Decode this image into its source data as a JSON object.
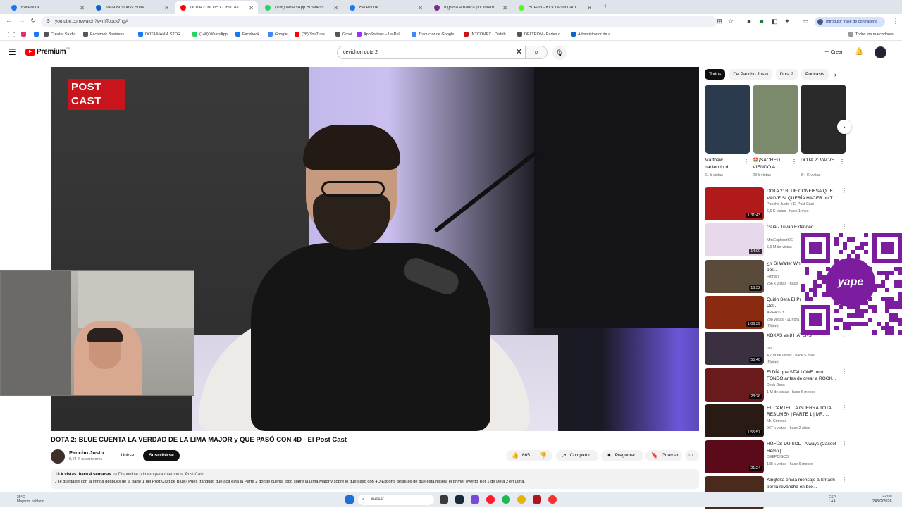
{
  "browser": {
    "tabs": [
      {
        "label": "Facebook",
        "color": "#1877f2",
        "active": false
      },
      {
        "label": "Meta Business Suite",
        "color": "#0a66c2",
        "active": false
      },
      {
        "label": "DOTA 2: BLUE CUENTA LA V...",
        "color": "#ff0000",
        "active": true
      },
      {
        "label": "(108) WhatsApp Business",
        "color": "#25d366",
        "active": false
      },
      {
        "label": "Facebook",
        "color": "#1877f2",
        "active": false
      },
      {
        "label": "Ingresa a Banca por Internet B...",
        "color": "#7a2b8f",
        "active": false
      },
      {
        "label": "Stream - Kick Dashboard",
        "color": "#53fc18",
        "active": false
      }
    ],
    "new_tab": "+",
    "url": "youtube.com/watch?v=nIToock7hgA",
    "sync_label": "Introducir frase de contraseña",
    "bookmarks": [
      {
        "label": "",
        "color": "#e1306c"
      },
      {
        "label": "",
        "color": "#1877f2"
      },
      {
        "label": "Creator Studio",
        "color": "#555"
      },
      {
        "label": "Facebook Business...",
        "color": "#555"
      },
      {
        "label": "DOTA MANIA STOR...",
        "color": "#1877f2"
      },
      {
        "label": "(140) WhatsApp",
        "color": "#25d366"
      },
      {
        "label": "Facebook",
        "color": "#1877f2"
      },
      {
        "label": "Google",
        "color": "#4285f4"
      },
      {
        "label": "(28) YouTube",
        "color": "#ff0000"
      },
      {
        "label": "Gmail",
        "color": "#555"
      },
      {
        "label": "AppSorteos – La Rul...",
        "color": "#9b30ff"
      },
      {
        "label": "Traductor de Google",
        "color": "#4285f4"
      },
      {
        "label": "INTCOMEX - Distrib...",
        "color": "#c8141b"
      },
      {
        "label": "DELTRON - Partes d...",
        "color": "#555"
      },
      {
        "label": "Administrador de a...",
        "color": "#0a66c2"
      }
    ],
    "all_bookmarks": "Todos los marcadores"
  },
  "youtube": {
    "logo": "Premium",
    "logo_sup": "PE",
    "search_value": "cevichon dota 2",
    "create_label": "Crear"
  },
  "video": {
    "overlay_logo": "POST CAST",
    "title": "DOTA 2: BLUE CUENTA LA VERDAD DE LA LIMA MAJOR y QUE PASÓ CON 4D - El Post Cast",
    "channel": "Pancho Justo",
    "subscribers": "9,64 K suscriptores",
    "join_label": "Unirse",
    "subscribe_label": "Suscribirse",
    "likes": "665",
    "share_label": "Compartir",
    "ask_label": "Preguntar",
    "save_label": "Guardar",
    "views": "13 k vistas",
    "ago": "hace 4 semanas",
    "members": "Disponible primero para miembros",
    "tag": "Post Cast",
    "description": "¿Te quedaste con la intriga después de la parte 1 del Post Cast de Blue? Pues tranquilo que acá está la Parte 2 donde cuenta todo sobre la Lima Major y sobre lo que pasó con 4D Esports después de que esta hiciera el primer evento Tier 1 de Dota 2 en Lima."
  },
  "sidebar": {
    "chips": [
      "Todos",
      "De Pancho Justo",
      "Dota 2",
      "Pódcasts"
    ],
    "shorts": [
      {
        "title": "Matthew haciendo d...",
        "views": "61 k vistas",
        "bg": "#2c3a4e"
      },
      {
        "title": "🤩¡SACRED VIENDO A ...",
        "views": "23 k vistas",
        "bg": "#7a8a6a"
      },
      {
        "title": "DOTA 2: VALVE ...",
        "views": "8,4 K vistas",
        "bg": "#2a2a2a"
      }
    ],
    "recs": [
      {
        "title": "DOTA 2: BLUE CONFIESA QUE VALVE SI QUERÍA HACER un T...",
        "channel": "Pancho Justo y El Post Cast",
        "views": "6,6 K vistas · hace 1 mes",
        "duration": "1:31:43",
        "bg": "#b01a1a",
        "new": ""
      },
      {
        "title": "Gaia - Tuvan Extended",
        "channel": "MiniExplorerSG",
        "views": "5,9 M de vistas",
        "duration": "14:00",
        "bg": "#e8d8ec",
        "new": ""
      },
      {
        "title": "¿Y Si Walter White... Sentenciado por...",
        "channel": "Hitman",
        "views": "256 k vistas · hace",
        "duration": "16:52",
        "bg": "#5a4a3a",
        "new": ""
      },
      {
        "title": "Quién Será El Próximo Presidente Del...",
        "channel": "AREA 973",
        "views": "298 vistas · 11 hora",
        "duration": "1:06:39",
        "bg": "#8a2a10",
        "new": "Nuevo"
      },
      {
        "title": "XOKAS vs 8 HATERS",
        "channel": "Illo",
        "views": "4,7 M de vistas · hace 5 días",
        "duration": "55:40",
        "bg": "#3a3040",
        "new": "Nuevo"
      },
      {
        "title": "El DÍA que STALLONE tocó FONDO antes de crear a ROCK...",
        "channel": "Deck Docs",
        "views": "1 M de vistas · hace 6 meses",
        "duration": "28:26",
        "bg": "#6a1a1a",
        "new": ""
      },
      {
        "title": "EL CARTEL LA GUERRA TOTAL RESUMEN | PARTE 1 | MR. ...",
        "channel": "Mr. Crimsac",
        "views": "967 k vistas · hace 2 años",
        "duration": "1:55:57",
        "bg": "#2a1a14",
        "new": ""
      },
      {
        "title": "RÜFÜS DU SOL - Always (Caseet Remix)",
        "channel": "DEEPDISCO",
        "views": "188 k vistas · hace 6 meses",
        "duration": "21:24",
        "bg": "#5a0a18",
        "new": ""
      },
      {
        "title": "Kingteka envía mensaje a Smash por la revancha en box...",
        "channel": "",
        "views": "",
        "duration": "",
        "bg": "#4a2a1a",
        "new": ""
      }
    ]
  },
  "qr_brand": "yape",
  "taskbar": {
    "weather_temp": "26°C",
    "weather_desc": "Mayorm. nublado",
    "search": "Buscar",
    "lang": "ESP",
    "lang2": "LAA",
    "time": "22:00",
    "date": "24/02/2026"
  }
}
